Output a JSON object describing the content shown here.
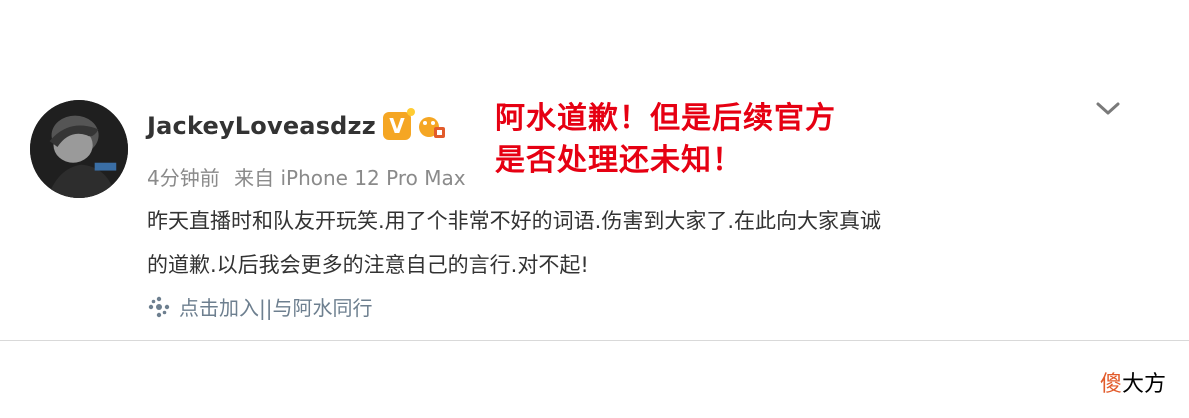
{
  "post": {
    "username": "JackeyLoveasdzz",
    "verified_badge_text": "V",
    "meta": {
      "time": "4分钟前",
      "source": "来自 iPhone 12 Pro Max"
    },
    "overlay_line1": "阿水道歉！但是后续官方",
    "overlay_line2": "是否处理还未知！",
    "content_line1": "昨天直播时和队友开玩笑.用了个非常不好的词语.伤害到大家了.在此向大家真诚",
    "content_line2": "的道歉.以后我会更多的注意自己的言行.对不起!",
    "topic_label": "点击加入||与阿水同行",
    "icons": {
      "verified": "verified-v-icon",
      "level": "weibo-level-icon",
      "menu": "chevron-down-icon",
      "topic": "topic-link-icon"
    }
  },
  "watermark": {
    "part1": "傻",
    "part2": "大方"
  },
  "colors": {
    "overlay_red": "#e60012",
    "verified_orange": "#f5a623",
    "topic_blue": "#6d7f8f",
    "meta_gray": "#8a8a8a",
    "watermark_accent": "#e25b2b"
  }
}
